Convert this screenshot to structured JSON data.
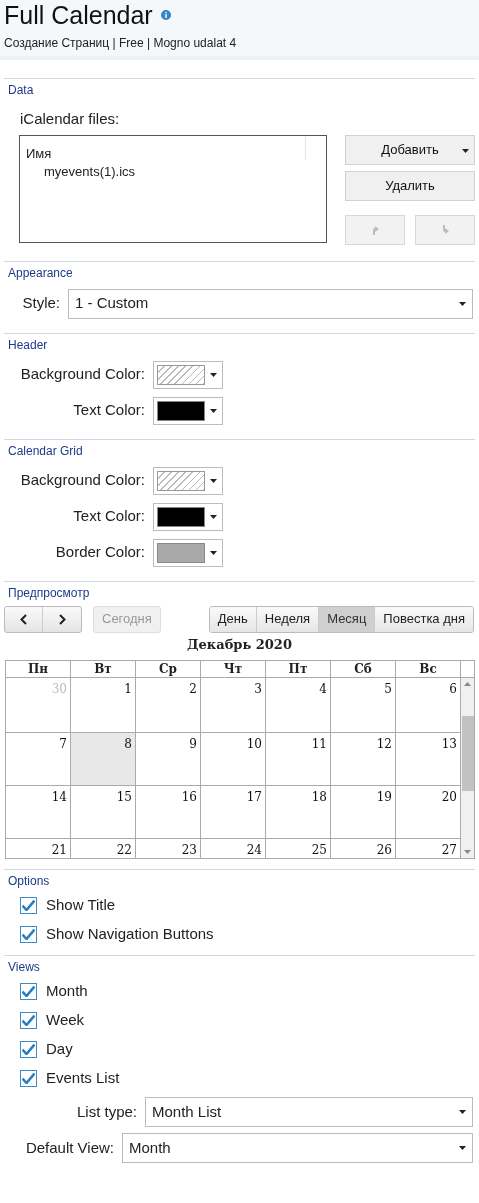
{
  "header": {
    "title": "Full Calendar",
    "subtitle": "Создание Страниц | Free | Mogno udalat 4"
  },
  "data": {
    "title": "Data",
    "files_label": "iCalendar files:",
    "list_header": "Имя",
    "files": [
      "myevents(1).ics"
    ],
    "buttons": [
      {
        "label": "Добавить",
        "dropdown": true
      },
      {
        "label": "Удалить",
        "dropdown": false
      }
    ],
    "move_buttons": [
      {
        "kind": "up",
        "disabled": true
      },
      {
        "kind": "down",
        "disabled": true
      }
    ]
  },
  "appearance": {
    "title": "Appearance",
    "style_label": "Style:",
    "style_value": "1 - Custom"
  },
  "header_colors": {
    "title": "Header",
    "colors": [
      {
        "label": "Background Color:",
        "kind": "none"
      },
      {
        "label": "Text Color:",
        "kind": "solid",
        "color": "#000000"
      }
    ]
  },
  "grid_colors": {
    "title": "Calendar Grid",
    "colors": [
      {
        "label": "Background Color:",
        "kind": "none"
      },
      {
        "label": "Text Color:",
        "kind": "solid",
        "color": "#000000"
      },
      {
        "label": "Border Color:",
        "kind": "solid",
        "color": "#a9a9a9"
      }
    ]
  },
  "preview": {
    "title": "Предпросмотр",
    "today_button": {
      "label": "Сегодня",
      "disabled": true
    },
    "view_tabs": [
      {
        "label": "День",
        "selected": false
      },
      {
        "label": "Неделя",
        "selected": false
      },
      {
        "label": "Месяц",
        "selected": true
      },
      {
        "label": "Повестка дня",
        "selected": false
      }
    ],
    "month_title": "Декабрь 2020",
    "weekdays": [
      "Пн",
      "Вт",
      "Ср",
      "Чт",
      "Пт",
      "Сб",
      "Вс"
    ],
    "weeks": [
      [
        {
          "day": "30",
          "other_month": true,
          "today": false
        },
        {
          "day": "1",
          "other_month": false,
          "today": false
        },
        {
          "day": "2",
          "other_month": false,
          "today": false
        },
        {
          "day": "3",
          "other_month": false,
          "today": false
        },
        {
          "day": "4",
          "other_month": false,
          "today": false
        },
        {
          "day": "5",
          "other_month": false,
          "today": false
        },
        {
          "day": "6",
          "other_month": false,
          "today": false
        }
      ],
      [
        {
          "day": "7",
          "other_month": false,
          "today": false
        },
        {
          "day": "8",
          "other_month": false,
          "today": true
        },
        {
          "day": "9",
          "other_month": false,
          "today": false
        },
        {
          "day": "10",
          "other_month": false,
          "today": false
        },
        {
          "day": "11",
          "other_month": false,
          "today": false
        },
        {
          "day": "12",
          "other_month": false,
          "today": false
        },
        {
          "day": "13",
          "other_month": false,
          "today": false
        }
      ],
      [
        {
          "day": "14",
          "other_month": false,
          "today": false
        },
        {
          "day": "15",
          "other_month": false,
          "today": false
        },
        {
          "day": "16",
          "other_month": false,
          "today": false
        },
        {
          "day": "17",
          "other_month": false,
          "today": false
        },
        {
          "day": "18",
          "other_month": false,
          "today": false
        },
        {
          "day": "19",
          "other_month": false,
          "today": false
        },
        {
          "day": "20",
          "other_month": false,
          "today": false
        }
      ],
      [
        {
          "day": "21",
          "other_month": false,
          "today": false
        },
        {
          "day": "22",
          "other_month": false,
          "today": false
        },
        {
          "day": "23",
          "other_month": false,
          "today": false
        },
        {
          "day": "24",
          "other_month": false,
          "today": false
        },
        {
          "day": "25",
          "other_month": false,
          "today": false
        },
        {
          "day": "26",
          "other_month": false,
          "today": false
        },
        {
          "day": "27",
          "other_month": false,
          "today": false
        }
      ]
    ]
  },
  "options": {
    "title": "Options",
    "checkboxes": [
      {
        "label": "Show Title",
        "checked": true
      },
      {
        "label": "Show Navigation Buttons",
        "checked": true
      }
    ]
  },
  "views": {
    "title": "Views",
    "checkboxes": [
      {
        "label": "Month",
        "checked": true
      },
      {
        "label": "Week",
        "checked": true
      },
      {
        "label": "Day",
        "checked": true
      },
      {
        "label": "Events List",
        "checked": true
      }
    ],
    "list_type_label": "List type:",
    "list_type_value": "Month List",
    "default_view_label": "Default View:",
    "default_view_value": "Month"
  }
}
